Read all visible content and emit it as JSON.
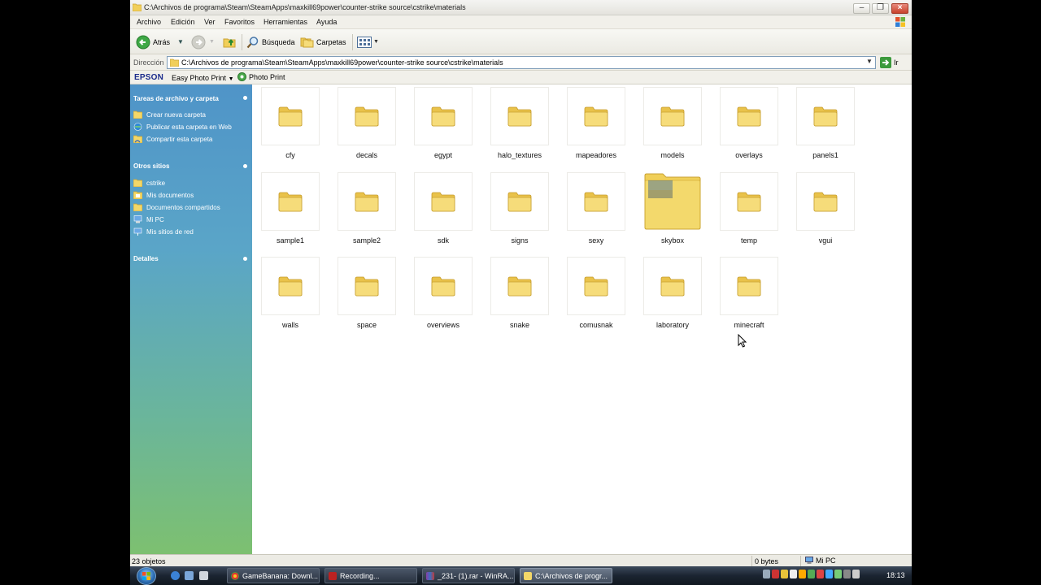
{
  "window": {
    "title": "C:\\Archivos de programa\\Steam\\SteamApps\\maxkill69power\\counter-strike source\\cstrike\\materials"
  },
  "menu": [
    "Archivo",
    "Edición",
    "Ver",
    "Favoritos",
    "Herramientas",
    "Ayuda"
  ],
  "toolbar": {
    "back_label": "Atrás",
    "search_label": "Búsqueda",
    "folders_label": "Carpetas"
  },
  "address": {
    "label": "Dirección",
    "value": "C:\\Archivos de programa\\Steam\\SteamApps\\maxkill69power\\counter-strike source\\cstrike\\materials",
    "go_label": "Ir"
  },
  "epson": {
    "logo": "EPSON",
    "menu_label": "Easy Photo Print",
    "photo_print_label": "Photo Print"
  },
  "sidebar": {
    "tasks_title": "Tareas de archivo y carpeta",
    "tasks": [
      "Crear nueva carpeta",
      "Publicar esta carpeta en Web",
      "Compartir esta carpeta"
    ],
    "places_title": "Otros sitios",
    "places": [
      "cstrike",
      "Mis documentos",
      "Documentos compartidos",
      "Mi PC",
      "Mis sitios de red"
    ],
    "details_title": "Detalles"
  },
  "folders": [
    "cfy",
    "decals",
    "egypt",
    "halo_textures",
    "mapeadores",
    "models",
    "overlays",
    "panels1",
    "sample1",
    "sample2",
    "sdk",
    "signs",
    "sexy",
    "skybox",
    "temp",
    "vgui",
    "walls",
    "space",
    "overviews",
    "snake",
    "comusnak",
    "laboratory",
    "minecraft"
  ],
  "status": {
    "count": "23 objetos",
    "size": "0 bytes",
    "location": "Mi PC"
  },
  "taskbar": {
    "buttons": [
      "GameBanana: Downl...",
      "Recording...",
      "_231- (1).rar - WinRA...",
      "C:\\Archivos de progr..."
    ],
    "clock": "18:13"
  },
  "colors": {
    "sidebar_top": "#4f94c8",
    "sidebar_bottom": "#7dc070",
    "folder_yellow": "#f3d768",
    "taskbar": "#1b2431"
  }
}
